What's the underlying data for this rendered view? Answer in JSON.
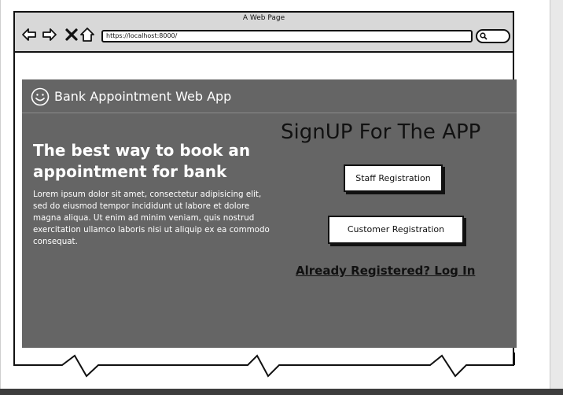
{
  "browser": {
    "window_title": "A Web Page",
    "url": "https://localhost:8000/",
    "icons": [
      "back-arrow-icon",
      "forward-arrow-icon",
      "close-x-icon",
      "home-icon",
      "search-icon"
    ]
  },
  "app": {
    "title": "Bank Appointment Web App",
    "hero_heading": "The best way to book an appointment for bank",
    "hero_text": "Lorem ipsum dolor sit amet, consectetur adipisicing elit, sed do eiusmod tempor incididunt ut labore et dolore magna aliqua. Ut enim ad minim veniam, quis nostrud exercitation ullamco laboris nisi ut aliquip ex ea commodo consequat.",
    "signup_title": "SignUP For The APP",
    "staff_button": "Staff Registration",
    "customer_button": "Customer Registration",
    "login_link": "Already Registered? Log In"
  },
  "colors": {
    "panel": "#656565",
    "chrome": "#d8d8d8",
    "text_light": "#ffffff",
    "text_dark": "#111111"
  }
}
